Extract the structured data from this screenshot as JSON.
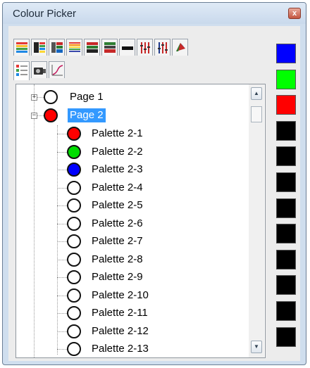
{
  "window": {
    "title": "Colour Picker",
    "close_glyph": "x"
  },
  "tabs": {
    "row1": [
      {
        "icon": "horizontal-rainbow-bars-icon"
      },
      {
        "icon": "gradient-bars-icon"
      },
      {
        "icon": "gradient-bars-alt-icon"
      },
      {
        "icon": "rainbow-stripes-icon"
      },
      {
        "icon": "red-green-bars-icon"
      },
      {
        "icon": "green-red-bars-icon"
      },
      {
        "icon": "black-bar-icon"
      },
      {
        "icon": "rgb-sliders-icon"
      },
      {
        "icon": "hsv-sliders-icon"
      },
      {
        "icon": "colour-wheel-icon"
      }
    ],
    "row2": [
      {
        "icon": "palette-tree-icon",
        "active": true
      },
      {
        "icon": "camera-icon"
      },
      {
        "icon": "graph-curve-icon"
      }
    ]
  },
  "tree": {
    "pages": [
      {
        "label": "Page 1",
        "color": "#ffffff",
        "expanded": false,
        "expander": "+"
      },
      {
        "label": "Page 2",
        "color": "#ff0000",
        "expanded": true,
        "selected": true,
        "expander": "−"
      }
    ],
    "palettes": [
      {
        "label": "Palette 2-1",
        "color": "#ff0000"
      },
      {
        "label": "Palette 2-2",
        "color": "#00dd00"
      },
      {
        "label": "Palette 2-3",
        "color": "#0000ff"
      },
      {
        "label": "Palette 2-4",
        "color": "#ffffff"
      },
      {
        "label": "Palette 2-5",
        "color": "#ffffff"
      },
      {
        "label": "Palette 2-6",
        "color": "#ffffff"
      },
      {
        "label": "Palette 2-7",
        "color": "#ffffff"
      },
      {
        "label": "Palette 2-8",
        "color": "#ffffff"
      },
      {
        "label": "Palette 2-9",
        "color": "#ffffff"
      },
      {
        "label": "Palette 2-10",
        "color": "#ffffff"
      },
      {
        "label": "Palette 2-11",
        "color": "#ffffff"
      },
      {
        "label": "Palette 2-12",
        "color": "#ffffff"
      },
      {
        "label": "Palette 2-13",
        "color": "#ffffff"
      }
    ]
  },
  "scrollbar": {
    "up_glyph": "▲",
    "down_glyph": "▼"
  },
  "swatches": [
    "#0000ff",
    "#00ff00",
    "#ff0000",
    "#000000",
    "#000000",
    "#000000",
    "#000000",
    "#000000",
    "#000000",
    "#000000",
    "#000000",
    "#000000"
  ]
}
